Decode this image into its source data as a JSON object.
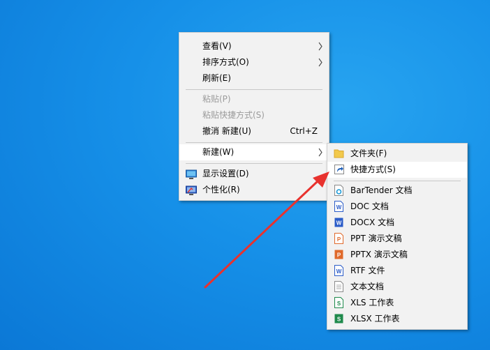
{
  "context_menu": {
    "view": "查看(V)",
    "sort_by": "排序方式(O)",
    "refresh": "刷新(E)",
    "paste": "粘贴(P)",
    "paste_shortcut": "粘贴快捷方式(S)",
    "undo_new": "撤消 新建(U)",
    "undo_shortcut": "Ctrl+Z",
    "new": "新建(W)",
    "display_settings": "显示设置(D)",
    "personalize": "个性化(R)"
  },
  "new_submenu": {
    "folder": "文件夹(F)",
    "shortcut": "快捷方式(S)",
    "items": [
      {
        "label": "BarTender 文档",
        "icon": "bartender-doc-icon"
      },
      {
        "label": "DOC 文档",
        "icon": "word-doc-icon"
      },
      {
        "label": "DOCX 文档",
        "icon": "word-docx-icon"
      },
      {
        "label": "PPT 演示文稿",
        "icon": "ppt-icon"
      },
      {
        "label": "PPTX 演示文稿",
        "icon": "pptx-icon"
      },
      {
        "label": "RTF 文件",
        "icon": "rtf-icon"
      },
      {
        "label": "文本文档",
        "icon": "text-doc-icon"
      },
      {
        "label": "XLS 工作表",
        "icon": "xls-icon"
      },
      {
        "label": "XLSX 工作表",
        "icon": "xlsx-icon"
      }
    ]
  },
  "colors": {
    "desktop": "#1690e8",
    "annotation_arrow": "#e8322e",
    "word": "#2b5cc8",
    "powerpoint": "#e06a2b",
    "excel": "#1f8a4c"
  }
}
